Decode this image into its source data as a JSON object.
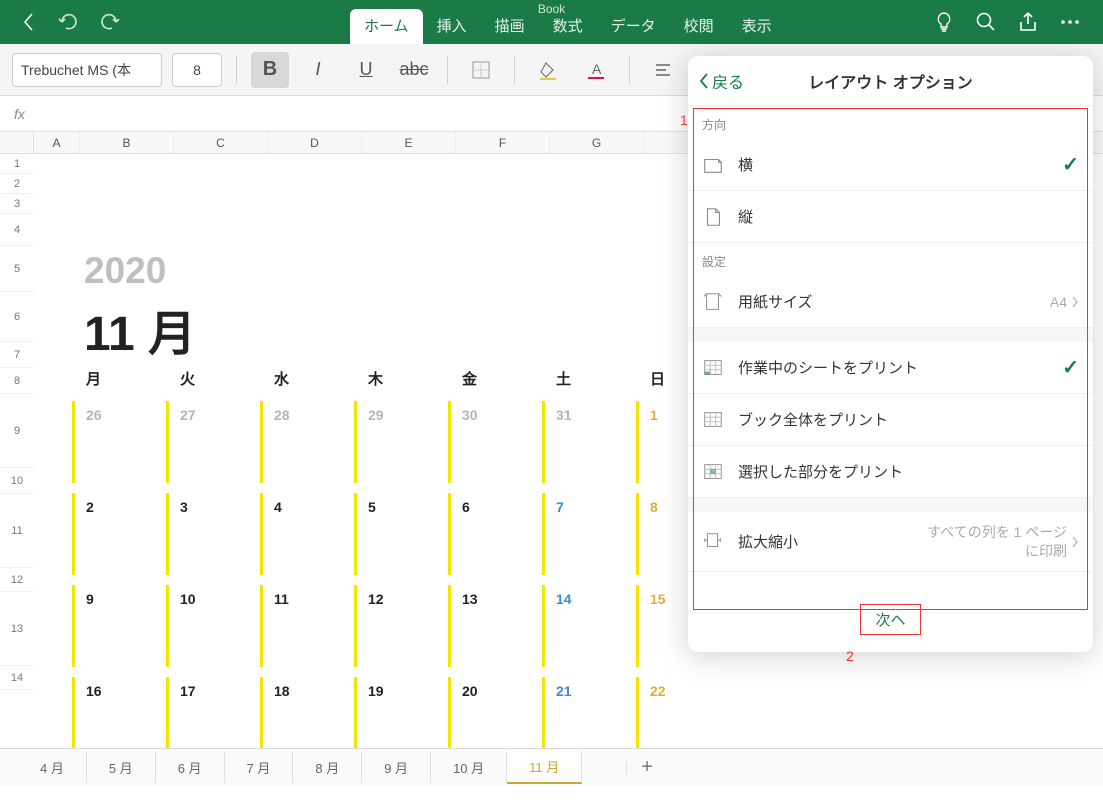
{
  "title": "Book",
  "ribbon": {
    "tabs": [
      "ホーム",
      "挿入",
      "描画",
      "数式",
      "データ",
      "校閲",
      "表示"
    ],
    "active": 0
  },
  "toolbar": {
    "font_name": "Trebuchet MS (本",
    "font_size": "8"
  },
  "formula_label": "fx",
  "columns": [
    "A",
    "B",
    "C",
    "D",
    "E",
    "F",
    "G"
  ],
  "rows": [
    "1",
    "2",
    "3",
    "4",
    "5",
    "6",
    "7",
    "8",
    "9",
    "10",
    "11",
    "12",
    "13",
    "14"
  ],
  "calendar": {
    "prev_month": "10 月",
    "year": "2020",
    "month_label": "11 月",
    "day_headers": [
      "月",
      "火",
      "水",
      "木",
      "金",
      "土",
      "日"
    ],
    "weeks": [
      [
        {
          "n": "26",
          "cls": "faded"
        },
        {
          "n": "27",
          "cls": "faded"
        },
        {
          "n": "28",
          "cls": "faded"
        },
        {
          "n": "29",
          "cls": "faded"
        },
        {
          "n": "30",
          "cls": "faded"
        },
        {
          "n": "31",
          "cls": "faded"
        },
        {
          "n": "1",
          "cls": "sun"
        }
      ],
      [
        {
          "n": "2"
        },
        {
          "n": "3"
        },
        {
          "n": "4"
        },
        {
          "n": "5"
        },
        {
          "n": "6"
        },
        {
          "n": "7",
          "cls": "sat"
        },
        {
          "n": "8",
          "cls": "sun"
        }
      ],
      [
        {
          "n": "9"
        },
        {
          "n": "10"
        },
        {
          "n": "11"
        },
        {
          "n": "12"
        },
        {
          "n": "13"
        },
        {
          "n": "14",
          "cls": "sat"
        },
        {
          "n": "15",
          "cls": "sun"
        }
      ],
      [
        {
          "n": "16"
        },
        {
          "n": "17"
        },
        {
          "n": "18"
        },
        {
          "n": "19"
        },
        {
          "n": "20"
        },
        {
          "n": "21",
          "cls": "sat"
        },
        {
          "n": "22",
          "cls": "sun"
        }
      ]
    ]
  },
  "sheet_tabs": [
    "4 月",
    "5 月",
    "6 月",
    "7 月",
    "8 月",
    "9 月",
    "10 月",
    "11 月"
  ],
  "sheet_tabs_active": 7,
  "panel": {
    "back": "戻る",
    "title": "レイアウト オプション",
    "section1_label": "方向",
    "orient_h": "横",
    "orient_v": "縦",
    "section2_label": "設定",
    "paper_size": "用紙サイズ",
    "paper_size_value": "A4",
    "print_active": "作業中のシートをプリント",
    "print_book": "ブック全体をプリント",
    "print_selection": "選択した部分をプリント",
    "scaling": "拡大縮小",
    "scaling_value": "すべての列を 1 ページに印刷",
    "next": "次へ"
  },
  "annotations": {
    "one": "1",
    "two": "2"
  }
}
